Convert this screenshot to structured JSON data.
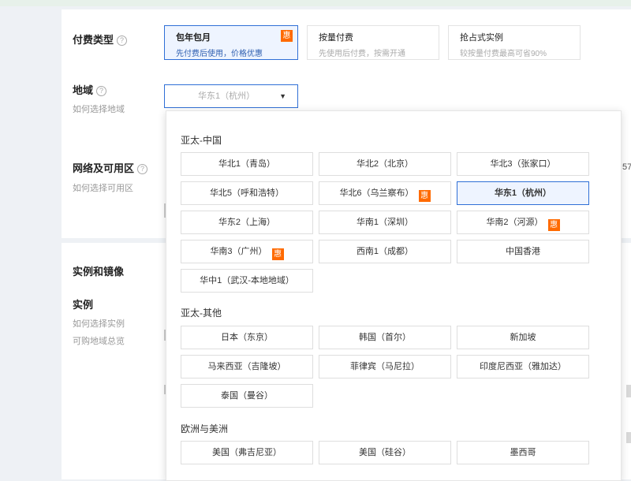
{
  "billing": {
    "label": "付费类型",
    "help_icon": "?",
    "options": [
      {
        "title": "包年包月",
        "desc": "先付费后使用，价格优惠",
        "badge": "惠",
        "selected": true
      },
      {
        "title": "按量付费",
        "desc": "先使用后付费，按需开通"
      },
      {
        "title": "抢占式实例",
        "desc": "较按量付费最高可省90%"
      }
    ]
  },
  "region": {
    "label": "地域",
    "help_icon": "?",
    "sub": "如何选择地域",
    "selected_value": "华东1（杭州）",
    "caret": "▼"
  },
  "network": {
    "label": "网络及可用区",
    "help_icon": "?",
    "sub": "如何选择可用区",
    "right_fragment": "57"
  },
  "instance_image": {
    "section_label": "实例和镜像",
    "instance_label": "实例",
    "sub1": "如何选择实例",
    "sub2": "可购地域总览"
  },
  "dropdown": {
    "groups": [
      {
        "title": "亚太-中国",
        "options": [
          {
            "label": "华北1（青岛）"
          },
          {
            "label": "华北2（北京）"
          },
          {
            "label": "华北3（张家口）"
          },
          {
            "label": "华北5（呼和浩特）"
          },
          {
            "label": "华北6（乌兰察布）",
            "badge": "惠"
          },
          {
            "label": "华东1（杭州）",
            "selected": true
          },
          {
            "label": "华东2（上海）"
          },
          {
            "label": "华南1（深圳）"
          },
          {
            "label": "华南2（河源）",
            "badge": "惠"
          },
          {
            "label": "华南3（广州）",
            "badge": "惠"
          },
          {
            "label": "西南1（成都）"
          },
          {
            "label": "中国香港"
          },
          {
            "label": "华中1（武汉-本地地域）"
          }
        ]
      },
      {
        "title": "亚太-其他",
        "options": [
          {
            "label": "日本（东京）"
          },
          {
            "label": "韩国（首尔）"
          },
          {
            "label": "新加坡"
          },
          {
            "label": "马来西亚（吉隆坡）"
          },
          {
            "label": "菲律宾（马尼拉）"
          },
          {
            "label": "印度尼西亚（雅加达）"
          },
          {
            "label": "泰国（曼谷）"
          }
        ]
      },
      {
        "title": "欧洲与美洲",
        "options": [
          {
            "label": "美国（弗吉尼亚）"
          },
          {
            "label": "美国（硅谷）"
          },
          {
            "label": "墨西哥"
          }
        ]
      }
    ]
  },
  "colors": {
    "accent": "#2f6fd6",
    "badge": "#ff6a00",
    "selected_bg": "#eef4ff"
  }
}
